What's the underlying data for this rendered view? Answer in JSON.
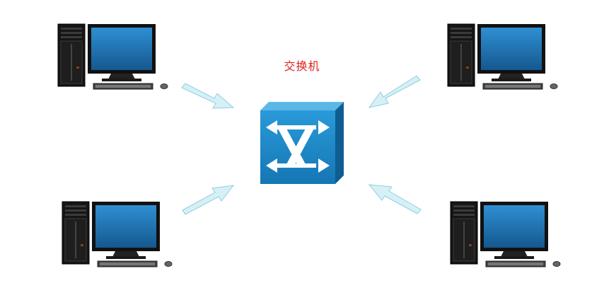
{
  "labels": {
    "switch": "交换机"
  },
  "nodes": [
    {
      "id": "pc-top-left",
      "type": "computer"
    },
    {
      "id": "pc-top-right",
      "type": "computer"
    },
    {
      "id": "pc-bottom-left",
      "type": "computer"
    },
    {
      "id": "pc-bottom-right",
      "type": "computer"
    },
    {
      "id": "switch",
      "type": "switch",
      "label": "交换机"
    }
  ],
  "edges": [
    {
      "from": "pc-top-left",
      "to": "switch"
    },
    {
      "from": "pc-top-right",
      "to": "switch"
    },
    {
      "from": "pc-bottom-left",
      "to": "switch"
    },
    {
      "from": "pc-bottom-right",
      "to": "switch"
    }
  ],
  "colors": {
    "label_red": "#e0201c",
    "switch_blue": "#1a86c8",
    "screen_blue": "#1d6fb0",
    "arrow_fill": "#d6f0f6",
    "arrow_stroke": "#8ecfe0",
    "tower": "#111111"
  }
}
